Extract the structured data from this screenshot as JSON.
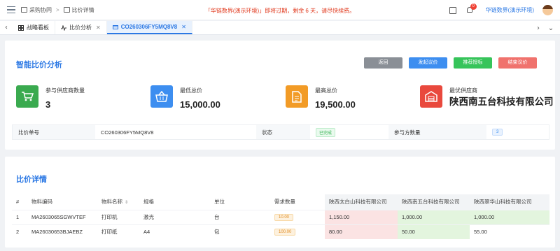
{
  "breadcrumb": {
    "root": "采购协同",
    "separator": ">",
    "current": "比价详情"
  },
  "notice": "「华链数界(演示环境)」即将过期，剩余 6 天，请尽快续费。",
  "user": {
    "name": "华链数界(演示环境)",
    "notifications": "0"
  },
  "tabs": [
    {
      "label": "战略看板",
      "icon": "dashboard-icon",
      "closable": false,
      "active": false
    },
    {
      "label": "比价分析",
      "icon": "pulse-icon",
      "closable": true,
      "active": false
    },
    {
      "label": "CO260306FY5MQ8V8",
      "icon": "card-icon",
      "closable": true,
      "active": true
    }
  ],
  "analysis": {
    "title": "智能比价分析",
    "buttons": {
      "back": "返回",
      "start": "发起议价",
      "recommend": "推荐授标",
      "finish": "结束议价"
    },
    "stats": [
      {
        "label": "参与供应商数量",
        "value": "3",
        "icon": "cart-icon",
        "color": "#3aaa4f"
      },
      {
        "label": "最低总价",
        "value": "15,000.00",
        "icon": "basket-icon",
        "color": "#3d8ef0"
      },
      {
        "label": "最高总价",
        "value": "19,500.00",
        "icon": "document-icon",
        "color": "#f29b26"
      },
      {
        "label": "最优供应商",
        "value": "陕西南五台科技有限公司",
        "icon": "warehouse-icon",
        "color": "#e9493d"
      }
    ],
    "info": {
      "order_no_label": "比价单号",
      "order_no": "CO260306FY5MQ8V8",
      "status_label": "状态",
      "status": "已完成",
      "participants_label": "参与方数量",
      "participants": "3"
    }
  },
  "details": {
    "title": "比价详情",
    "columns": [
      "#",
      "物料编码",
      "物料名称",
      "规格",
      "单位",
      "需求数量",
      "陕西太白山科技有限公司",
      "陕西南五台科技有限公司",
      "陕西翠华山科技有限公司"
    ],
    "rows": [
      {
        "index": "1",
        "code": "MA2603065SGWVTEF",
        "name": "打印机",
        "spec": "激光",
        "unit": "台",
        "qty": "10.00",
        "prices": [
          "1,150.00",
          "1,000.00",
          "1,000.00"
        ],
        "highlight": [
          "red",
          "green",
          "green"
        ]
      },
      {
        "index": "2",
        "code": "MA26030653BJAEBZ",
        "name": "打印纸",
        "spec": "A4",
        "unit": "包",
        "qty": "100.00",
        "prices": [
          "80.00",
          "50.00",
          "55.00"
        ],
        "highlight": [
          "red",
          "green",
          "none"
        ]
      }
    ]
  }
}
